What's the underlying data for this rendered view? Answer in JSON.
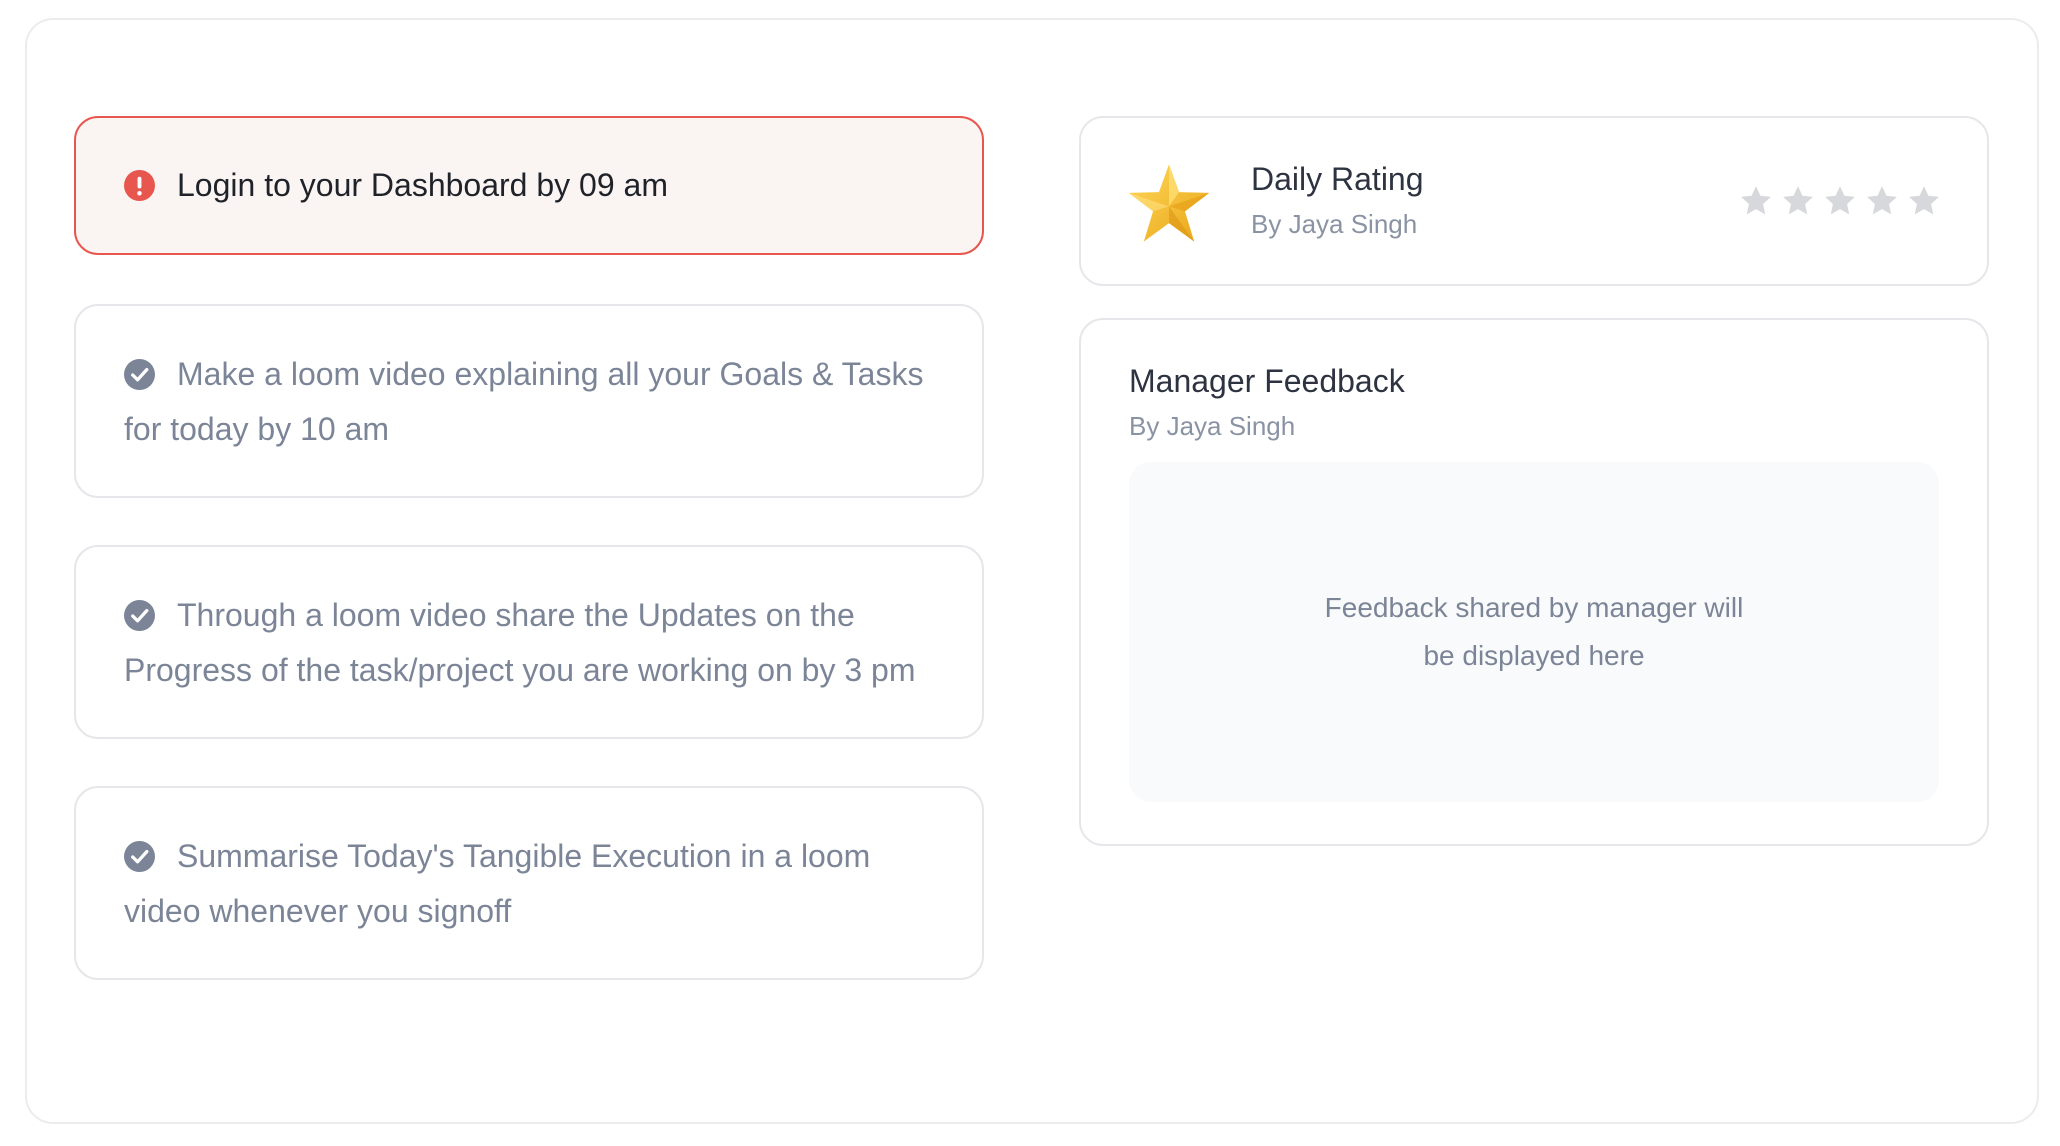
{
  "tasks": [
    {
      "icon": "exclamation-circle-icon",
      "status": "alert",
      "text": "Login to your Dashboard by 09 am"
    },
    {
      "icon": "check-circle-icon",
      "status": "done",
      "text": "Make a loom video explaining all your Goals & Tasks for today by 10 am"
    },
    {
      "icon": "check-circle-icon",
      "status": "done",
      "text": "Through a loom video share the Updates on the Progress of the task/project you are working on by 3 pm"
    },
    {
      "icon": "check-circle-icon",
      "status": "done",
      "text": "Summarise Today's Tangible Execution in a loom video whenever you signoff"
    }
  ],
  "daily_rating": {
    "title": "Daily Rating",
    "by": "By Jaya Singh",
    "rating": 0,
    "max": 5,
    "icon": "star-icon"
  },
  "manager_feedback": {
    "title": "Manager Feedback",
    "by": "By Jaya Singh",
    "placeholder": "Feedback shared by manager will be displayed here"
  },
  "colors": {
    "alert_red": "#e8574f",
    "alert_bg": "#faf4f2",
    "check_gray": "#7b8597",
    "star_gold": "#f2b632",
    "star_empty": "#d6d8dc"
  }
}
